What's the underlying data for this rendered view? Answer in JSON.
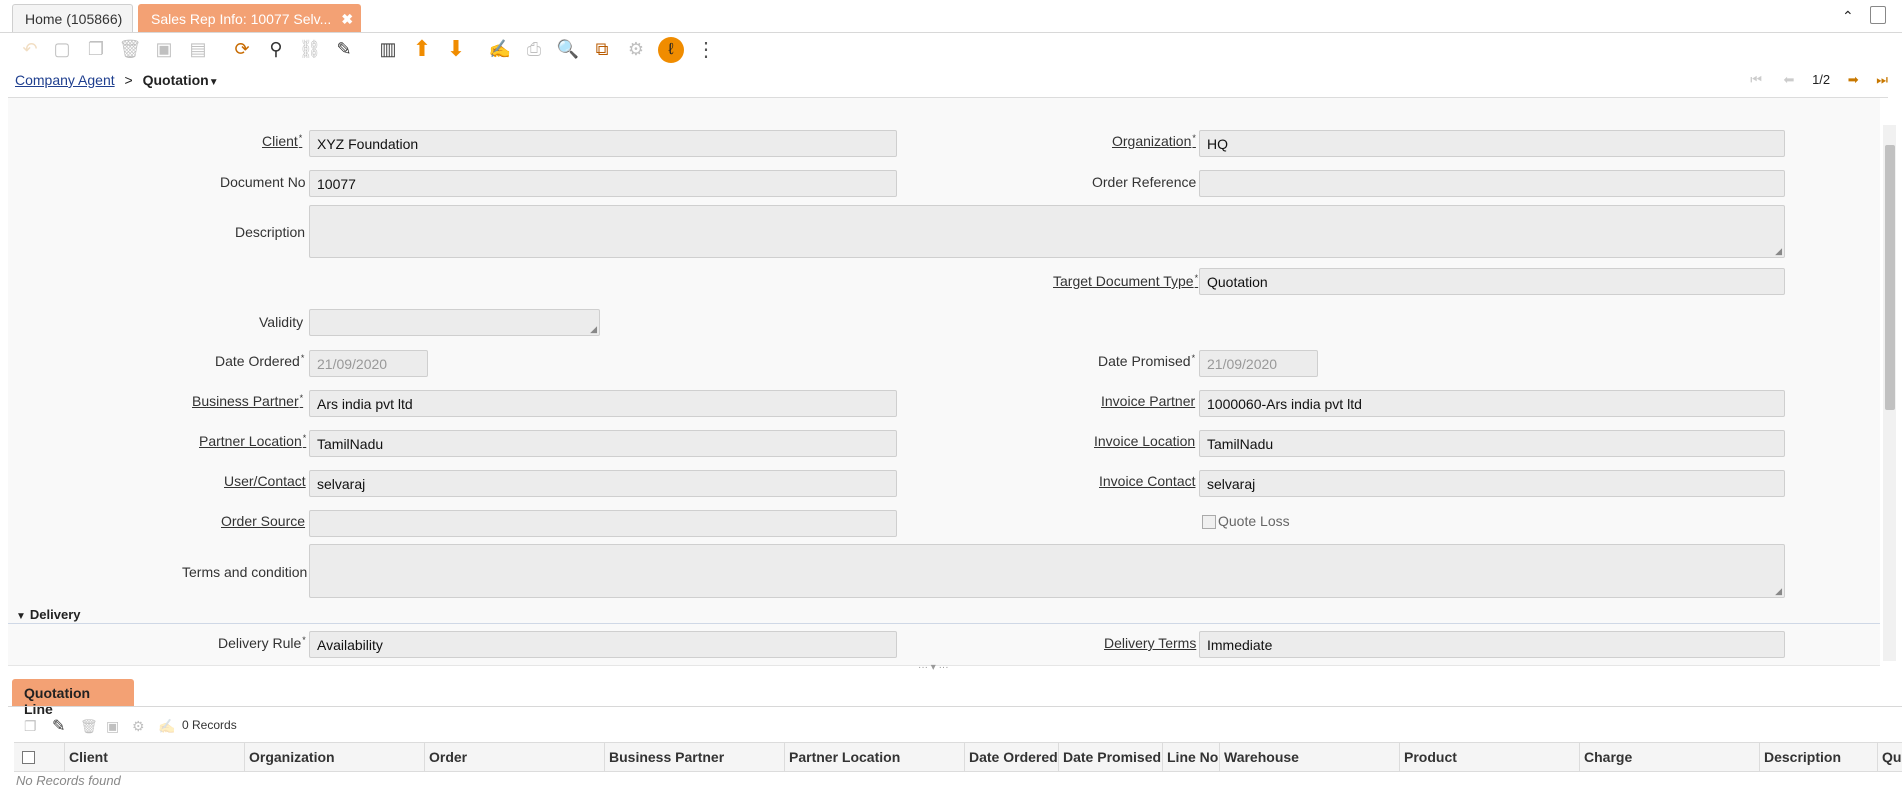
{
  "tabs": {
    "home": "Home (105866)",
    "active": "Sales Rep Info: 10077 Selv...",
    "close": "✖"
  },
  "breadcrumb": {
    "parent": "Company Agent",
    "separator": ">",
    "current": "Quotation"
  },
  "navigation": {
    "record_position": "1/2"
  },
  "form": {
    "client_label": "Client",
    "client": "XYZ Foundation",
    "organization_label": "Organization",
    "organization": "HQ",
    "document_no_label": "Document No",
    "document_no": "10077",
    "order_reference_label": "Order Reference",
    "order_reference": "",
    "description_label": "Description",
    "target_doc_type_label": "Target Document Type",
    "target_doc_type": "Quotation",
    "validity_label": "Validity",
    "date_ordered_label": "Date Ordered",
    "date_ordered": "21/09/2020",
    "date_promised_label": "Date Promised",
    "date_promised": "21/09/2020",
    "business_partner_label": "Business Partner",
    "business_partner": "Ars india pvt ltd",
    "invoice_partner_label": "Invoice Partner",
    "invoice_partner": "1000060-Ars india pvt ltd",
    "partner_location_label": "Partner Location",
    "partner_location": "TamilNadu",
    "invoice_location_label": "Invoice Location",
    "invoice_location": "TamilNadu",
    "user_contact_label": "User/Contact",
    "user_contact": "selvaraj",
    "invoice_contact_label": "Invoice Contact",
    "invoice_contact": "selvaraj",
    "order_source_label": "Order Source",
    "order_source": "",
    "quote_loss_label": "Quote Loss",
    "terms_label": "Terms and condition",
    "delivery_section": "Delivery",
    "delivery_rule_label": "Delivery Rule",
    "delivery_rule": "Availability",
    "delivery_terms_label": "Delivery Terms",
    "delivery_terms": "Immediate"
  },
  "detail": {
    "tab": "Quotation Line",
    "records": "0 Records",
    "columns": [
      "Client",
      "Organization",
      "Order",
      "Business Partner",
      "Partner Location",
      "Date Ordered",
      "Date Promised",
      "Line No",
      "Warehouse",
      "Product",
      "Charge",
      "Description",
      "Qu"
    ],
    "empty": "No Records found"
  },
  "colors": {
    "accent": "#f3a174",
    "link": "#1f3f8f",
    "icon_orange": "#f08c00"
  }
}
